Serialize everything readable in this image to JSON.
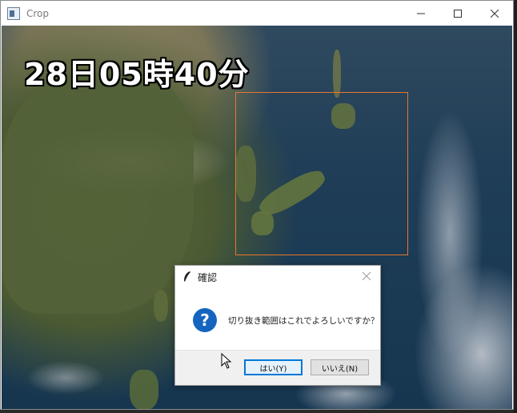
{
  "window": {
    "title": "Crop"
  },
  "overlay": {
    "timestamp": "28日05時40分"
  },
  "crop": {
    "color": "#e8772b"
  },
  "dialog": {
    "title": "確認",
    "message": "切り抜き範囲はこれでよろしいですか？",
    "yes_label": "はい(Y)",
    "no_label": "いいえ(N)"
  },
  "colors": {
    "accent": "#0078d7",
    "question_icon": "#1565c0"
  },
  "icons": [
    "app-icon",
    "minimize-icon",
    "maximize-icon",
    "close-icon",
    "feather-icon",
    "question-icon",
    "mouse-cursor-icon"
  ]
}
